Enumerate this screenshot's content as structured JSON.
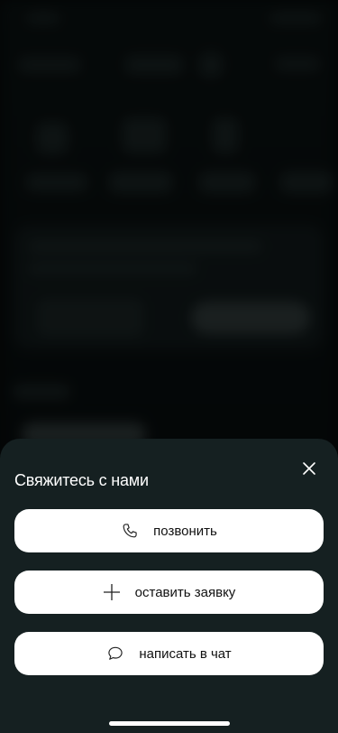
{
  "contact_sheet": {
    "title": "Свяжитесь с нами",
    "actions": [
      {
        "label": "позвонить",
        "icon": "phone-icon"
      },
      {
        "label": "оставить заявку",
        "icon": "plus-icon"
      },
      {
        "label": "написать в чат",
        "icon": "chat-bubble-icon"
      }
    ],
    "close_icon": "close-icon"
  },
  "colors": {
    "sheet_background": "#152021",
    "button_background": "#ffffff",
    "button_text": "#111111",
    "title_text": "#ffffff"
  }
}
